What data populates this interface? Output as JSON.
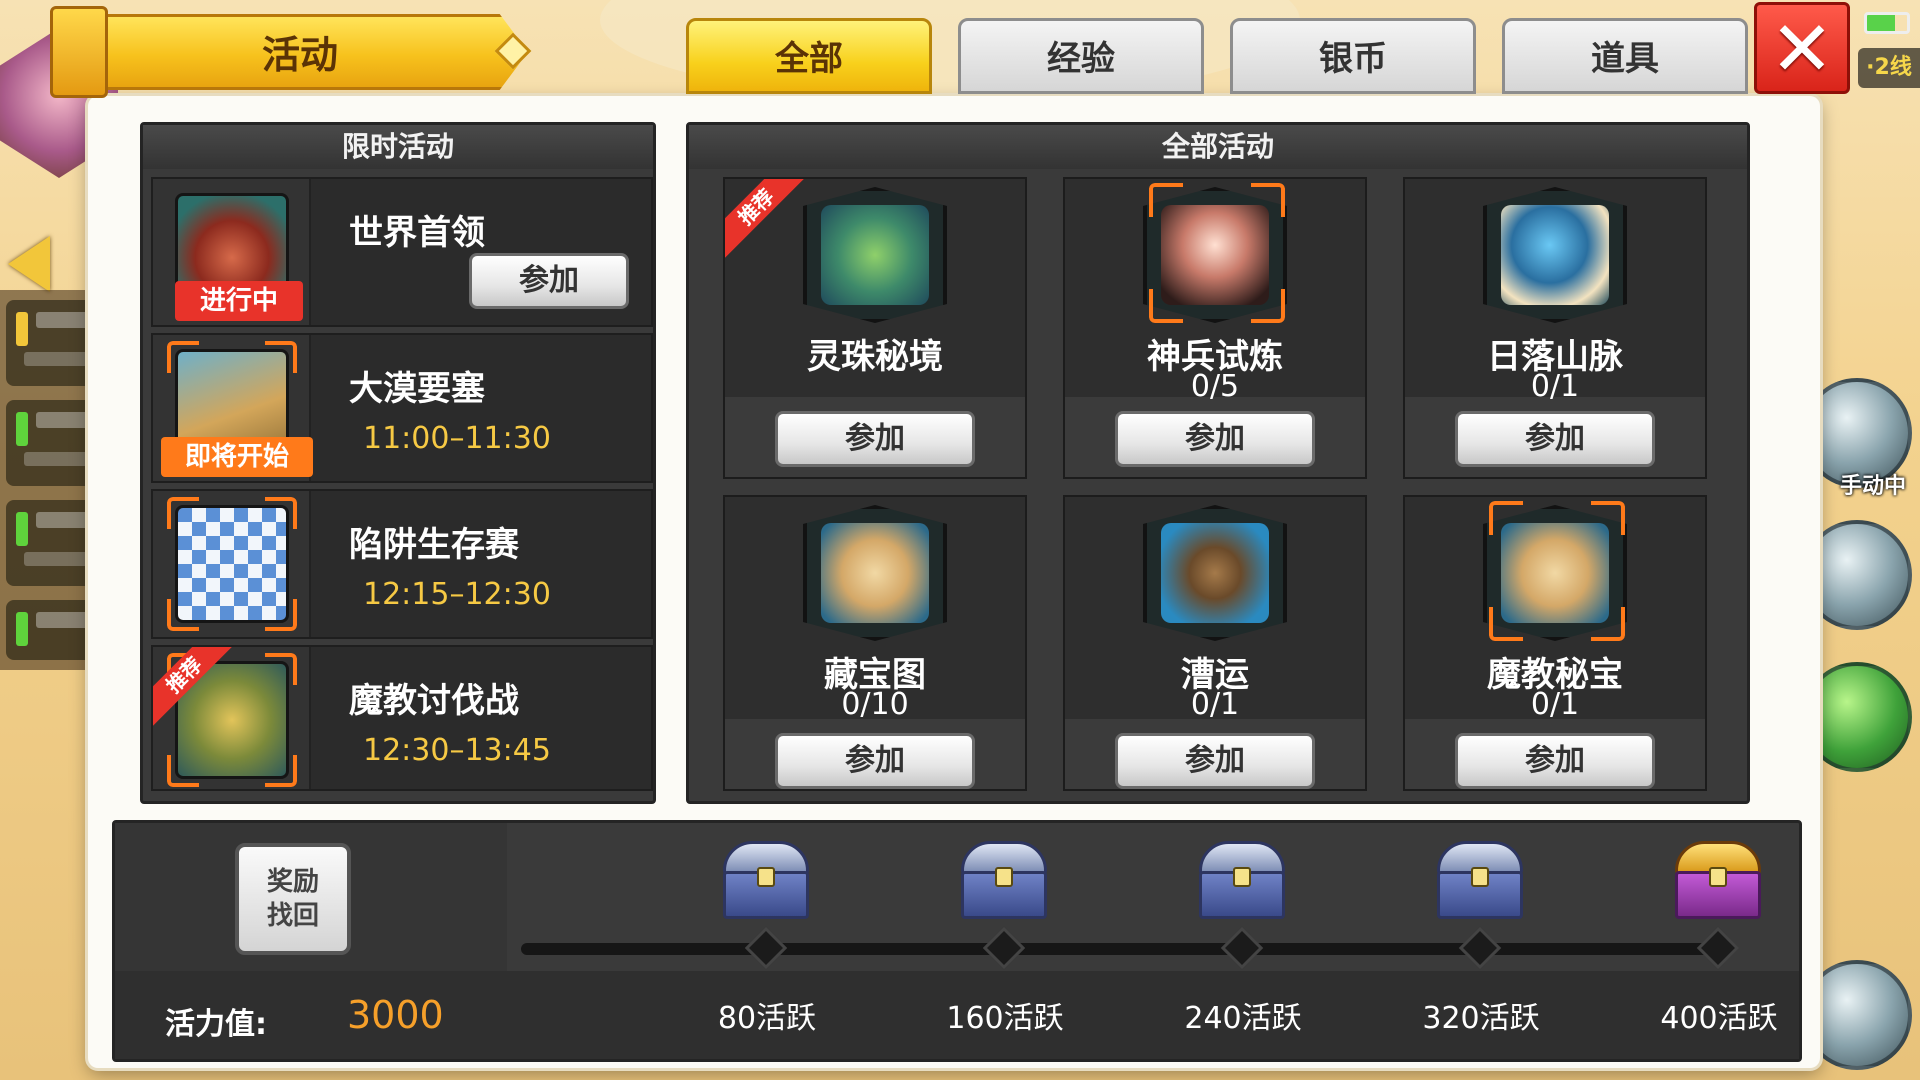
{
  "hud": {
    "line_badge": "·2线",
    "manual_label": "手动中"
  },
  "dialog": {
    "title": "活动",
    "close_glyph": "✕",
    "tabs": [
      {
        "label": "全部",
        "active": true
      },
      {
        "label": "经验",
        "active": false
      },
      {
        "label": "银币",
        "active": false
      },
      {
        "label": "道具",
        "active": false
      }
    ]
  },
  "limited": {
    "header": "限时活动",
    "rows": [
      {
        "name": "世界首领",
        "icon": "boss-icon",
        "badge": "进行中",
        "badge_color": "#e8332a",
        "join_label": "参加",
        "time": ""
      },
      {
        "name": "大漠要塞",
        "icon": "fortress-icon",
        "badge": "即将开始",
        "badge_color": "#ff7a1a",
        "time": "11:00–11:30"
      },
      {
        "name": "陷阱生存赛",
        "icon": "checker-floor-icon",
        "time": "12:15–12:30"
      },
      {
        "name": "魔教讨伐战",
        "icon": "demon-warrior-icon",
        "ribbon": "推荐",
        "time": "12:30–13:45"
      }
    ]
  },
  "all": {
    "header": "全部活动",
    "cards": [
      {
        "name": "灵珠秘境",
        "count": "",
        "icon": "island-icon",
        "ribbon": "推荐",
        "join_label": "参加"
      },
      {
        "name": "神兵试炼",
        "count": "0/5",
        "icon": "girl-portrait-icon",
        "highlight": true,
        "join_label": "参加"
      },
      {
        "name": "日落山脉",
        "count": "0/1",
        "icon": "mushroom-egg-icon",
        "join_label": "参加"
      },
      {
        "name": "藏宝图",
        "count": "0/10",
        "icon": "treasure-map-icon",
        "join_label": "参加"
      },
      {
        "name": "漕运",
        "count": "0/1",
        "icon": "boat-icon",
        "join_label": "参加"
      },
      {
        "name": "魔教秘宝",
        "count": "0/1",
        "icon": "scroll-map-icon",
        "highlight": true,
        "join_label": "参加"
      }
    ]
  },
  "rewards": {
    "recover_button": "奖励\n找回",
    "vitality_label": "活力值:",
    "vitality_value": "3000",
    "progress": 0,
    "milestones": [
      {
        "label": "80活跃",
        "chest": "silver-chest-icon"
      },
      {
        "label": "160活跃",
        "chest": "silver-chest-icon"
      },
      {
        "label": "240活跃",
        "chest": "silver-chest-icon"
      },
      {
        "label": "320活跃",
        "chest": "silver-chest-icon"
      },
      {
        "label": "400活跃",
        "chest": "gold-chest-icon"
      }
    ]
  },
  "colors": {
    "accent_yellow": "#f8d11c",
    "highlight_orange": "#ff7a1a",
    "time_text": "#f6c944",
    "vitality_value": "#f6a02a",
    "close_red": "#d9241a"
  }
}
